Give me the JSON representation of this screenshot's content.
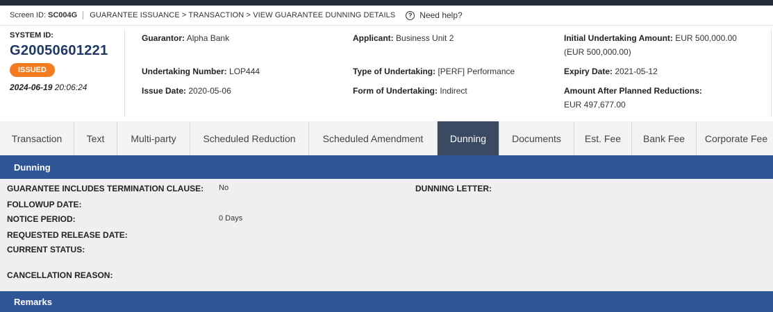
{
  "header": {
    "screen_id_label": "Screen ID:",
    "screen_id": "SC004G",
    "breadcrumb": "GUARANTEE ISSUANCE > TRANSACTION > VIEW GUARANTEE DUNNING DETAILS",
    "help": "Need help?"
  },
  "summary": {
    "system_id_label": "SYSTEM ID:",
    "system_id": "G20050601221",
    "status": "ISSUED",
    "date": "2024-06-19",
    "time": "20:06:24",
    "guarantor_label": "Guarantor:",
    "guarantor": "Alpha Bank",
    "applicant_label": "Applicant:",
    "applicant": "Business Unit 2",
    "initial_amount_label": "Initial Undertaking Amount:",
    "initial_amount": "EUR 500,000.00",
    "initial_amount_sub": "(EUR 500,000.00)",
    "undertaking_number_label": "Undertaking Number:",
    "undertaking_number": "LOP444",
    "type_label": "Type of Undertaking:",
    "type": "[PERF] Performance",
    "expiry_label": "Expiry Date:",
    "expiry": "2021-05-12",
    "issue_date_label": "Issue Date:",
    "issue_date": "2020-05-06",
    "form_label": "Form of Undertaking:",
    "form": "Indirect",
    "after_reductions_label": "Amount After Planned Reductions:",
    "after_reductions": "EUR 497,677.00"
  },
  "tabs": [
    {
      "label": "Transaction"
    },
    {
      "label": "Text"
    },
    {
      "label": "Multi-party"
    },
    {
      "label": "Scheduled Reduction"
    },
    {
      "label": "Scheduled Amendment"
    },
    {
      "label": "Dunning"
    },
    {
      "label": "Documents"
    },
    {
      "label": "Est. Fee"
    },
    {
      "label": "Bank Fee"
    },
    {
      "label": "Corporate Fee"
    }
  ],
  "dunning": {
    "title": "Dunning",
    "termination_label": "GUARANTEE INCLUDES TERMINATION CLAUSE:",
    "termination_value": "No",
    "dunning_letter_label": "DUNNING LETTER:",
    "followup_label": "FOLLOWUP DATE:",
    "notice_label": "NOTICE PERIOD:",
    "notice_value": "0 Days",
    "release_label": "REQUESTED RELEASE DATE:",
    "status_label": "CURRENT STATUS:",
    "cancellation_label": "CANCELLATION REASON:"
  },
  "remarks": {
    "title": "Remarks"
  },
  "colors": {
    "section_header": "#2f5597",
    "active_tab": "#3a4a63",
    "status_badge": "#f47b20",
    "system_id": "#1f3864"
  }
}
